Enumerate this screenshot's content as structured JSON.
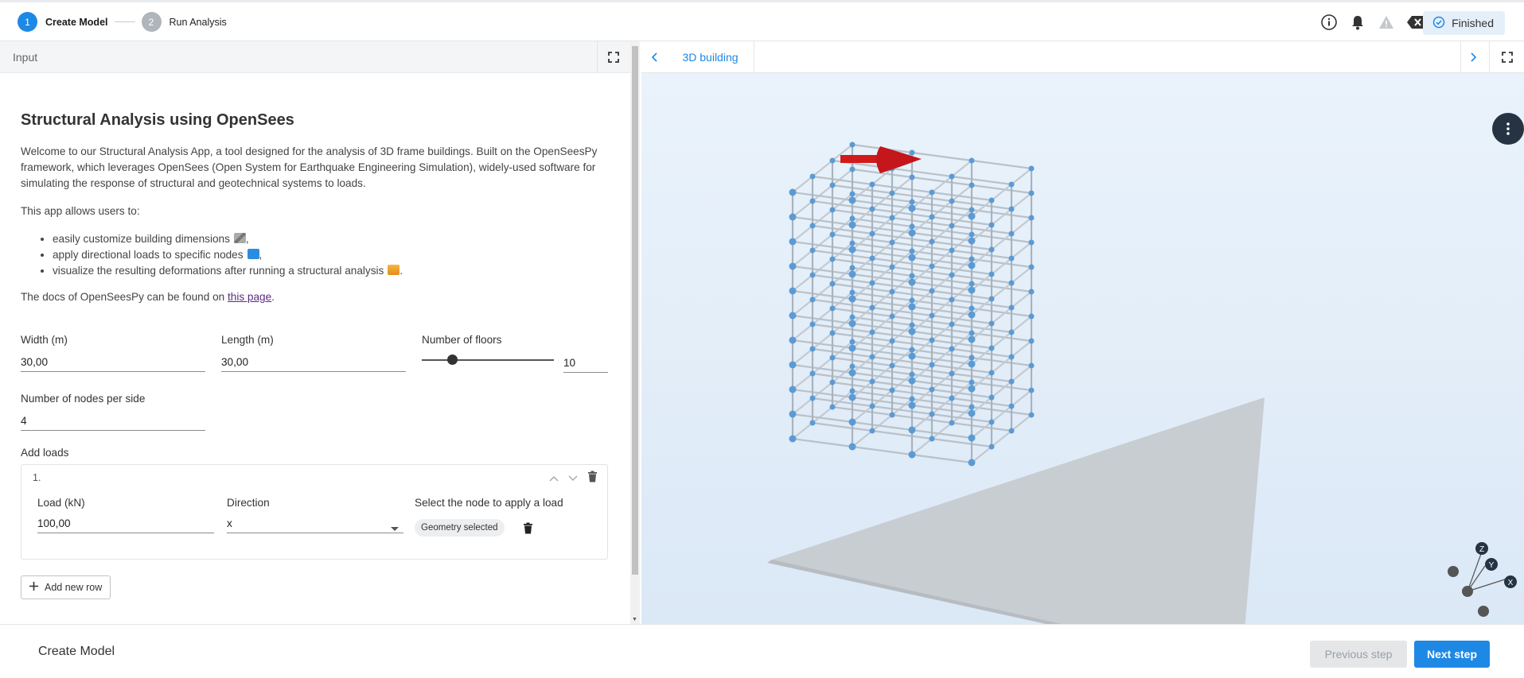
{
  "stepper": {
    "steps": [
      {
        "number": "1",
        "label": "Create Model"
      },
      {
        "number": "2",
        "label": "Run Analysis"
      }
    ]
  },
  "status": {
    "label": "Finished"
  },
  "input_panel": {
    "title": "Input",
    "app_title": "Structural Analysis using OpenSees",
    "intro": "Welcome to our Structural Analysis App, a tool designed for the analysis of 3D frame buildings. Built on the OpenSeesPy framework, which leverages OpenSees (Open System for Earthquake Engineering Simulation), widely-used software for simulating the response of structural and geotechnical systems to loads.",
    "allows": "This app allows users to:",
    "bullets": [
      "easily customize building dimensions",
      "apply directional loads to specific nodes",
      "visualize the resulting deformations after running a structural analysis"
    ],
    "docs_prefix": "The docs of OpenSeesPy can be found on",
    "docs_link": "this page",
    "width": {
      "label": "Width (m)",
      "value": "30,00"
    },
    "length": {
      "label": "Length (m)",
      "value": "30,00"
    },
    "floors": {
      "label": "Number of floors",
      "value": "10",
      "slider_fraction": 0.23
    },
    "nodes_per_side": {
      "label": "Number of nodes per side",
      "value": "4"
    },
    "add_loads": {
      "label": "Add loads",
      "rows": [
        {
          "number": "1.",
          "load_label": "Load (kN)",
          "load_value": "100,00",
          "direction_label": "Direction",
          "direction_value": "x",
          "node_label": "Select the node to apply a load",
          "node_value": "Geometry selected"
        }
      ],
      "add_button": "Add new row"
    }
  },
  "view_panel": {
    "tab": "3D building"
  },
  "footer": {
    "step_name": "Create Model",
    "previous": "Previous step",
    "next": "Next step"
  },
  "colors": {
    "accent": "#1e88e5",
    "load_arrow": "#d11a1a",
    "node": "#5b9bd5"
  }
}
